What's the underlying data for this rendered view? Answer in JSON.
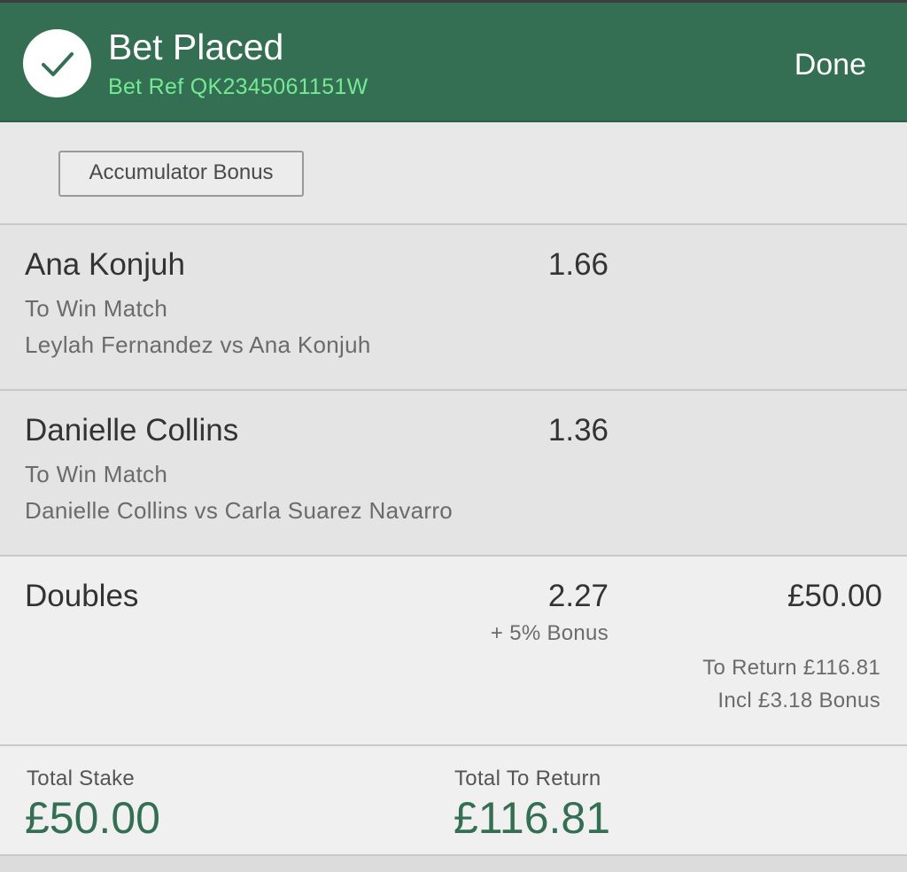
{
  "header": {
    "title": "Bet Placed",
    "bet_ref": "Bet Ref QK2345061151W",
    "done_label": "Done",
    "icon": "checkmark-icon"
  },
  "bonus_strip": {
    "tag_label": "Accumulator Bonus"
  },
  "selections": [
    {
      "name": "Ana Konjuh",
      "odds": "1.66",
      "market": "To Win Match",
      "event": "Leylah Fernandez vs Ana Konjuh"
    },
    {
      "name": "Danielle Collins",
      "odds": "1.36",
      "market": "To Win Match",
      "event": "Danielle Collins vs Carla Suarez Navarro"
    }
  ],
  "doubles": {
    "label": "Doubles",
    "odds": "2.27",
    "bonus": "+ 5% Bonus",
    "stake": "£50.00",
    "to_return": "To Return £116.81",
    "incl_bonus": "Incl £3.18 Bonus"
  },
  "totals": {
    "stake_label": "Total Stake",
    "stake_value": "£50.00",
    "return_label": "Total To Return",
    "return_value": "£116.81"
  },
  "colors": {
    "header_bg": "#346e53",
    "ref_text": "#74ea94",
    "total_value": "#346e53"
  }
}
